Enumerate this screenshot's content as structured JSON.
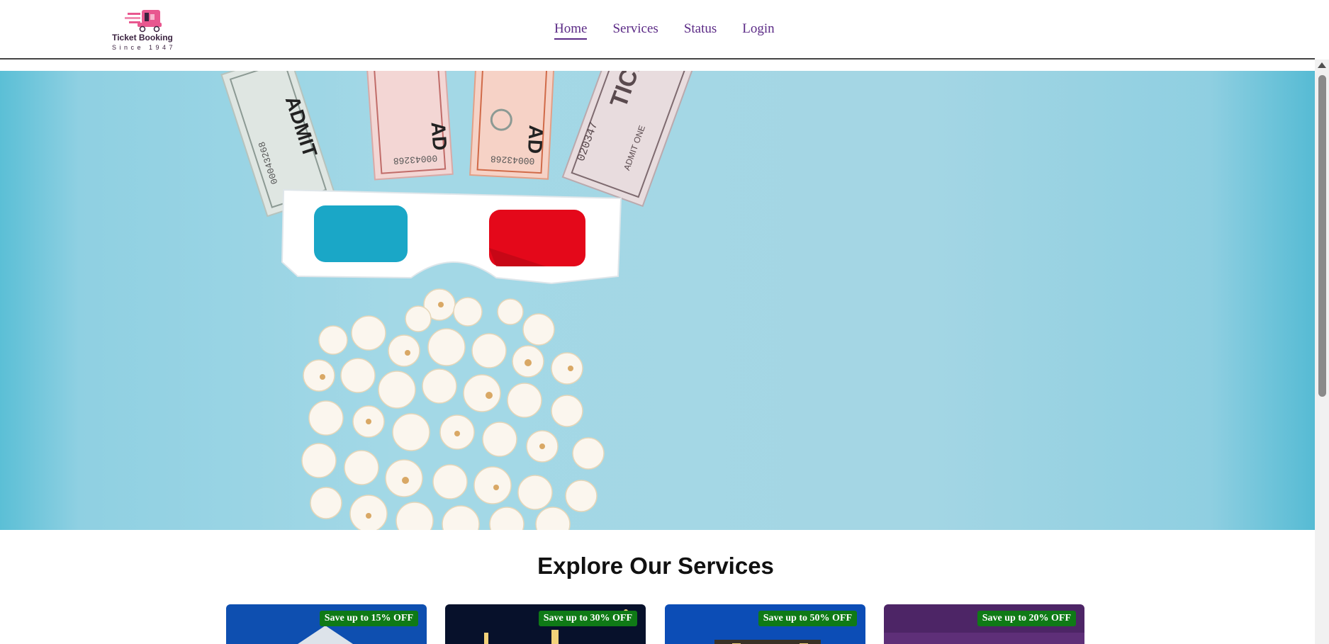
{
  "navbar": {
    "logo_text": "Ticket Booking",
    "logo_tagline": "Since 1947",
    "links": [
      {
        "label": "Home",
        "active": true
      },
      {
        "label": "Services",
        "active": false
      },
      {
        "label": "Status",
        "active": false
      },
      {
        "label": "Login",
        "active": false
      }
    ]
  },
  "hero": {
    "tickets": [
      {
        "lines": [
          "ADMIT",
          "00043268"
        ]
      },
      {
        "lines": [
          "AD",
          "00043268"
        ]
      },
      {
        "lines": [
          "AD",
          "00043268"
        ]
      },
      {
        "lines": [
          "TICK",
          "020347",
          "ADMIT ONE"
        ]
      }
    ]
  },
  "services": {
    "title": "Explore Our Services",
    "cards": [
      {
        "badge": "Save up to 15% OFF",
        "color": "#0e4fb0"
      },
      {
        "badge": "Save up to 30% OFF",
        "color": "#07112b"
      },
      {
        "badge": "Save up to 50% OFF",
        "color": "#0c4db6"
      },
      {
        "badge": "Save up to 20% OFF",
        "color": "#4d2566"
      }
    ]
  },
  "colors": {
    "nav_link": "#5b2a86",
    "hero_bg": "#a3d8e6",
    "badge_bg": "#0f7a16"
  }
}
